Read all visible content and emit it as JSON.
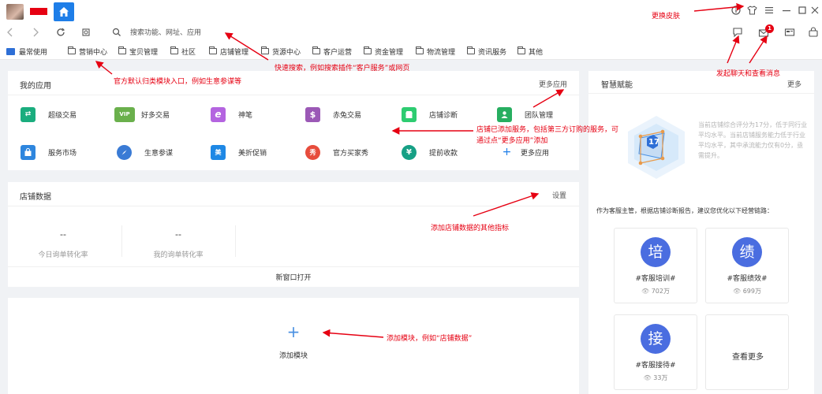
{
  "search": {
    "placeholder": "搜索功能、网址、应用"
  },
  "bookmarks": [
    {
      "label": "最常使用"
    },
    {
      "label": "营销中心"
    },
    {
      "label": "宝贝管理"
    },
    {
      "label": "社区"
    },
    {
      "label": "店铺管理"
    },
    {
      "label": "货源中心"
    },
    {
      "label": "客户运营"
    },
    {
      "label": "资金管理"
    },
    {
      "label": "物流管理"
    },
    {
      "label": "资讯服务"
    },
    {
      "label": "其他"
    }
  ],
  "my_apps": {
    "title": "我的应用",
    "more": "更多应用",
    "items": [
      {
        "label": "超级交易",
        "icon": "transfer-icon",
        "color": "#1aad7e"
      },
      {
        "label": "好多交易",
        "icon": "vip-icon",
        "color": "#6ab04c",
        "glyph": "VIP"
      },
      {
        "label": "神笔",
        "icon": "pen-icon",
        "color": "#b464e0",
        "glyph": "e"
      },
      {
        "label": "赤兔交易",
        "icon": "money-bag-icon",
        "color": "#9b59b6",
        "glyph": "$"
      },
      {
        "label": "店铺诊断",
        "icon": "shop-icon",
        "color": "#2ecc71"
      },
      {
        "label": "团队管理",
        "icon": "team-icon",
        "color": "#27ae60"
      },
      {
        "label": "服务市场",
        "icon": "bag-icon",
        "color": "#2e86de"
      },
      {
        "label": "生意参谋",
        "icon": "compass-icon",
        "color": "#3a7bd5"
      },
      {
        "label": "美折促销",
        "icon": "discount-icon",
        "color": "#1e88e5",
        "glyph": "美"
      },
      {
        "label": "官方买家秀",
        "icon": "show-icon",
        "color": "#e74c3c",
        "glyph": "秀"
      },
      {
        "label": "提前收款",
        "icon": "receipt-icon",
        "color": "#16a085",
        "glyph": "¥"
      },
      {
        "label": "更多应用",
        "icon": "plus-icon",
        "color": "#1e7ee8",
        "glyph": "+"
      }
    ]
  },
  "store_data": {
    "title": "店铺数据",
    "settings": "设置",
    "metrics": [
      {
        "value": "--",
        "label": "今日询单转化率"
      },
      {
        "value": "--",
        "label": "我的询单转化率"
      }
    ],
    "open_new_window": "新窗口打开"
  },
  "add_module": {
    "label": "添加模块"
  },
  "smart": {
    "title": "智慧赋能",
    "more": "更多",
    "score": "17",
    "desc": "当前店铺综合评分为17分，低于同行业平均水平。当前店铺服务能力低于行业平均水平，其中承流能力仅有0分，亟需提升。",
    "advice": "作为客服主管，根据店铺诊断报告，建议您优化以下经营链路：",
    "tiles": [
      {
        "char": "培",
        "name": "#客服培训#",
        "views": "702万",
        "color": "#4a6de0"
      },
      {
        "char": "绩",
        "name": "#客服绩效#",
        "views": "699万",
        "color": "#4a6de0"
      },
      {
        "char": "接",
        "name": "#客服接待#",
        "views": "33万",
        "color": "#4a6de0"
      }
    ],
    "see_more": "查看更多"
  },
  "annotations": {
    "skin": "更换皮肤",
    "search": "快速搜索，例如搜索插件“客户服务”或网页",
    "official": "官方默认归类模块入口，例如生意参谋等",
    "apps_line1": "店铺已添加服务，包括第三方订购的服务，可",
    "apps_line2": "通过点“更多应用”添加",
    "store": "添加店铺数据的其他指标",
    "chat": "发起聊天和查看消息",
    "module": "添加模块，例如“店铺数据”"
  },
  "notifications": {
    "count": "1"
  },
  "accent": "#1e7ee8",
  "annotation_color": "#e60012"
}
